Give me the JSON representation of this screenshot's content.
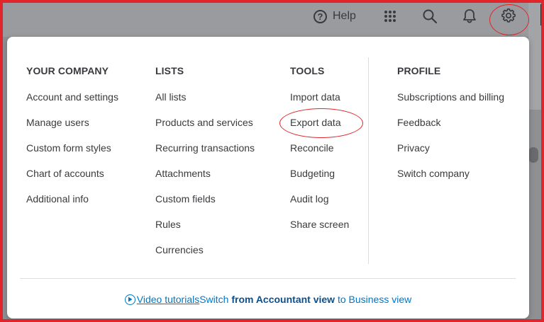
{
  "topbar": {
    "help_label": "Help",
    "help_icon_glyph": "?"
  },
  "menu": {
    "your_company": {
      "heading": "YOUR COMPANY",
      "items": [
        "Account and settings",
        "Manage users",
        "Custom form styles",
        "Chart of accounts",
        "Additional info"
      ]
    },
    "lists": {
      "heading": "LISTS",
      "items": [
        "All lists",
        "Products and services",
        "Recurring transactions",
        "Attachments",
        "Custom fields",
        "Rules",
        "Currencies"
      ]
    },
    "tools": {
      "heading": "TOOLS",
      "items": [
        "Import data",
        "Export data",
        "Reconcile",
        "Budgeting",
        "Audit log",
        "Share screen"
      ]
    },
    "profile": {
      "heading": "PROFILE",
      "items": [
        "Subscriptions and billing",
        "Feedback",
        "Privacy",
        "Switch company"
      ]
    }
  },
  "footer": {
    "tutorials_label": "Video tutorials",
    "switch_prefix": "Switch ",
    "switch_bold": "from Accountant view",
    "switch_suffix": " to Business view"
  },
  "colors": {
    "annotation": "#e0262b",
    "link": "#0077c5",
    "text": "#393a3d"
  }
}
